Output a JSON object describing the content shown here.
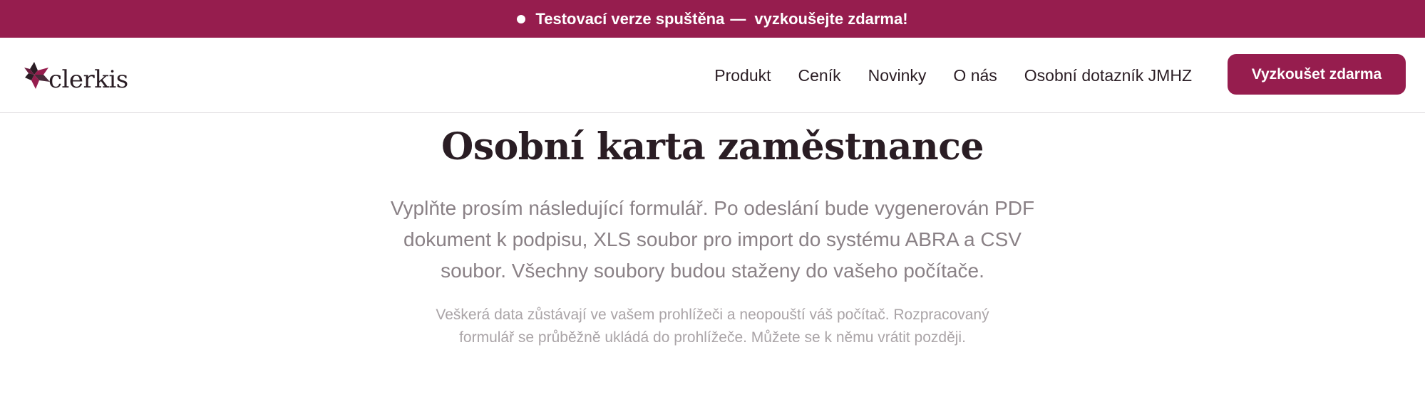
{
  "announcement": {
    "text": "Testovací verze spuštěna",
    "dash": "—",
    "link": "vyzkoušejte zdarma!"
  },
  "header": {
    "logo_text": "clerkis",
    "nav": [
      {
        "label": "Produkt"
      },
      {
        "label": "Ceník"
      },
      {
        "label": "Novinky"
      },
      {
        "label": "O nás"
      },
      {
        "label": "Osobní dotazník JMHZ"
      }
    ],
    "cta_label": "Vyzkoušet zdarma"
  },
  "main": {
    "title": "Osobní karta zaměstnance",
    "lead": "Vyplňte prosím následující formulář. Po odeslání bude vygenerován PDF dokument k podpisu, XLS soubor pro import do systému ABRA a CSV soubor. Všechny soubory budou staženy do vašeho počítače.",
    "note": "Veškerá data zůstávají ve vašem prohlížeči a neopouští váš počítač. Rozpracovaný formulář se průběžně ukládá do prohlížeče. Můžete se k němu vrátit později."
  },
  "colors": {
    "brand": "#961d4e",
    "text_dark": "#2a1d24",
    "text_muted": "#8a8186",
    "text_light": "#aaa4a7"
  },
  "icons": {
    "logo_mark": "star-logo-icon",
    "announcement_dot": "dot-icon"
  }
}
